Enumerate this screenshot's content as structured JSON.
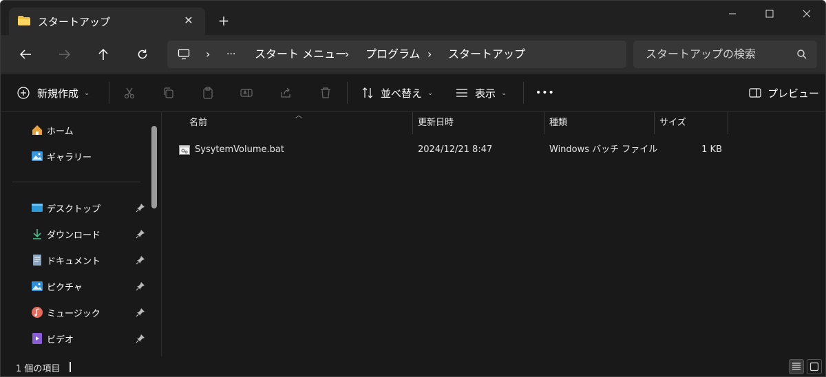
{
  "tab": {
    "title": "スタートアップ",
    "icon": "folder-icon"
  },
  "window_controls": {
    "minimize": "minimize-icon",
    "maximize": "maximize-icon",
    "close": "close-icon"
  },
  "address": {
    "crumbs": [
      "スタート メニュー",
      "プログラム",
      "スタートアップ"
    ],
    "ellipsis": "···"
  },
  "search": {
    "placeholder": "スタートアップの検索"
  },
  "commands": {
    "new": "新規作成",
    "sort": "並べ替え",
    "view": "表示",
    "more": "•••",
    "preview": "プレビュー"
  },
  "sidebar": {
    "top": [
      {
        "label": "ホーム",
        "icon": "home-icon"
      },
      {
        "label": "ギャラリー",
        "icon": "gallery-icon"
      }
    ],
    "pinned": [
      {
        "label": "デスクトップ",
        "icon": "desktop-icon"
      },
      {
        "label": "ダウンロード",
        "icon": "download-icon"
      },
      {
        "label": "ドキュメント",
        "icon": "documents-icon"
      },
      {
        "label": "ピクチャ",
        "icon": "pictures-icon"
      },
      {
        "label": "ミュージック",
        "icon": "music-icon"
      },
      {
        "label": "ビデオ",
        "icon": "video-icon"
      }
    ]
  },
  "columns": {
    "name": "名前",
    "modified": "更新日時",
    "type": "種類",
    "size": "サイズ"
  },
  "files": [
    {
      "name": "SysytemVolume.bat",
      "modified": "2024/12/21 8:47",
      "type": "Windows バッチ ファイル",
      "size": "1 KB"
    }
  ],
  "status": {
    "count_text": "1 個の項目"
  },
  "colors": {
    "background": "#191919",
    "navbar": "#2c2c2c",
    "accent": "#60cdff"
  }
}
